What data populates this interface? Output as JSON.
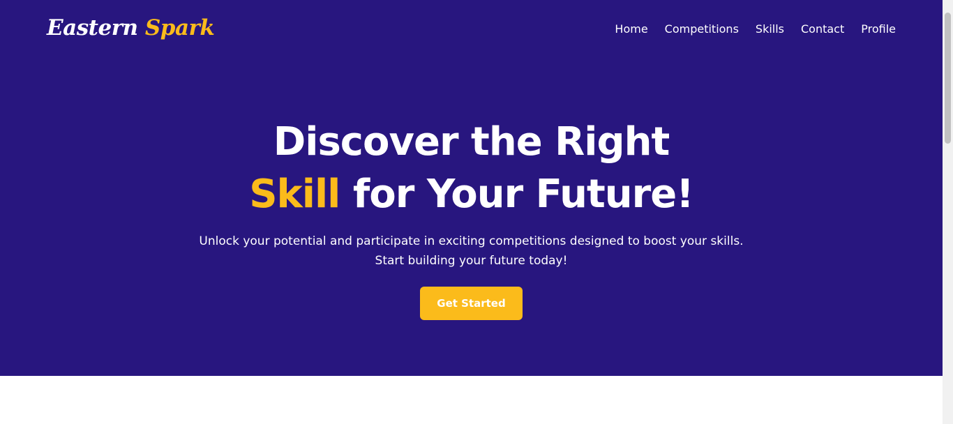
{
  "brand": {
    "word1": "Eastern",
    "word2": "Spark"
  },
  "nav": {
    "items": [
      "Home",
      "Competitions",
      "Skills",
      "Contact",
      "Profile"
    ]
  },
  "hero": {
    "line1": "Discover the Right",
    "accent": "Skill",
    "line2_rest": " for Your Future!",
    "sub1": "Unlock your potential and participate in exciting competitions designed to boost your skills.",
    "sub2": "Start building your future today!",
    "cta_label": "Get Started"
  },
  "colors": {
    "hero_bg": "#28167f",
    "accent": "#fbbb1b",
    "text": "#ffffff"
  }
}
